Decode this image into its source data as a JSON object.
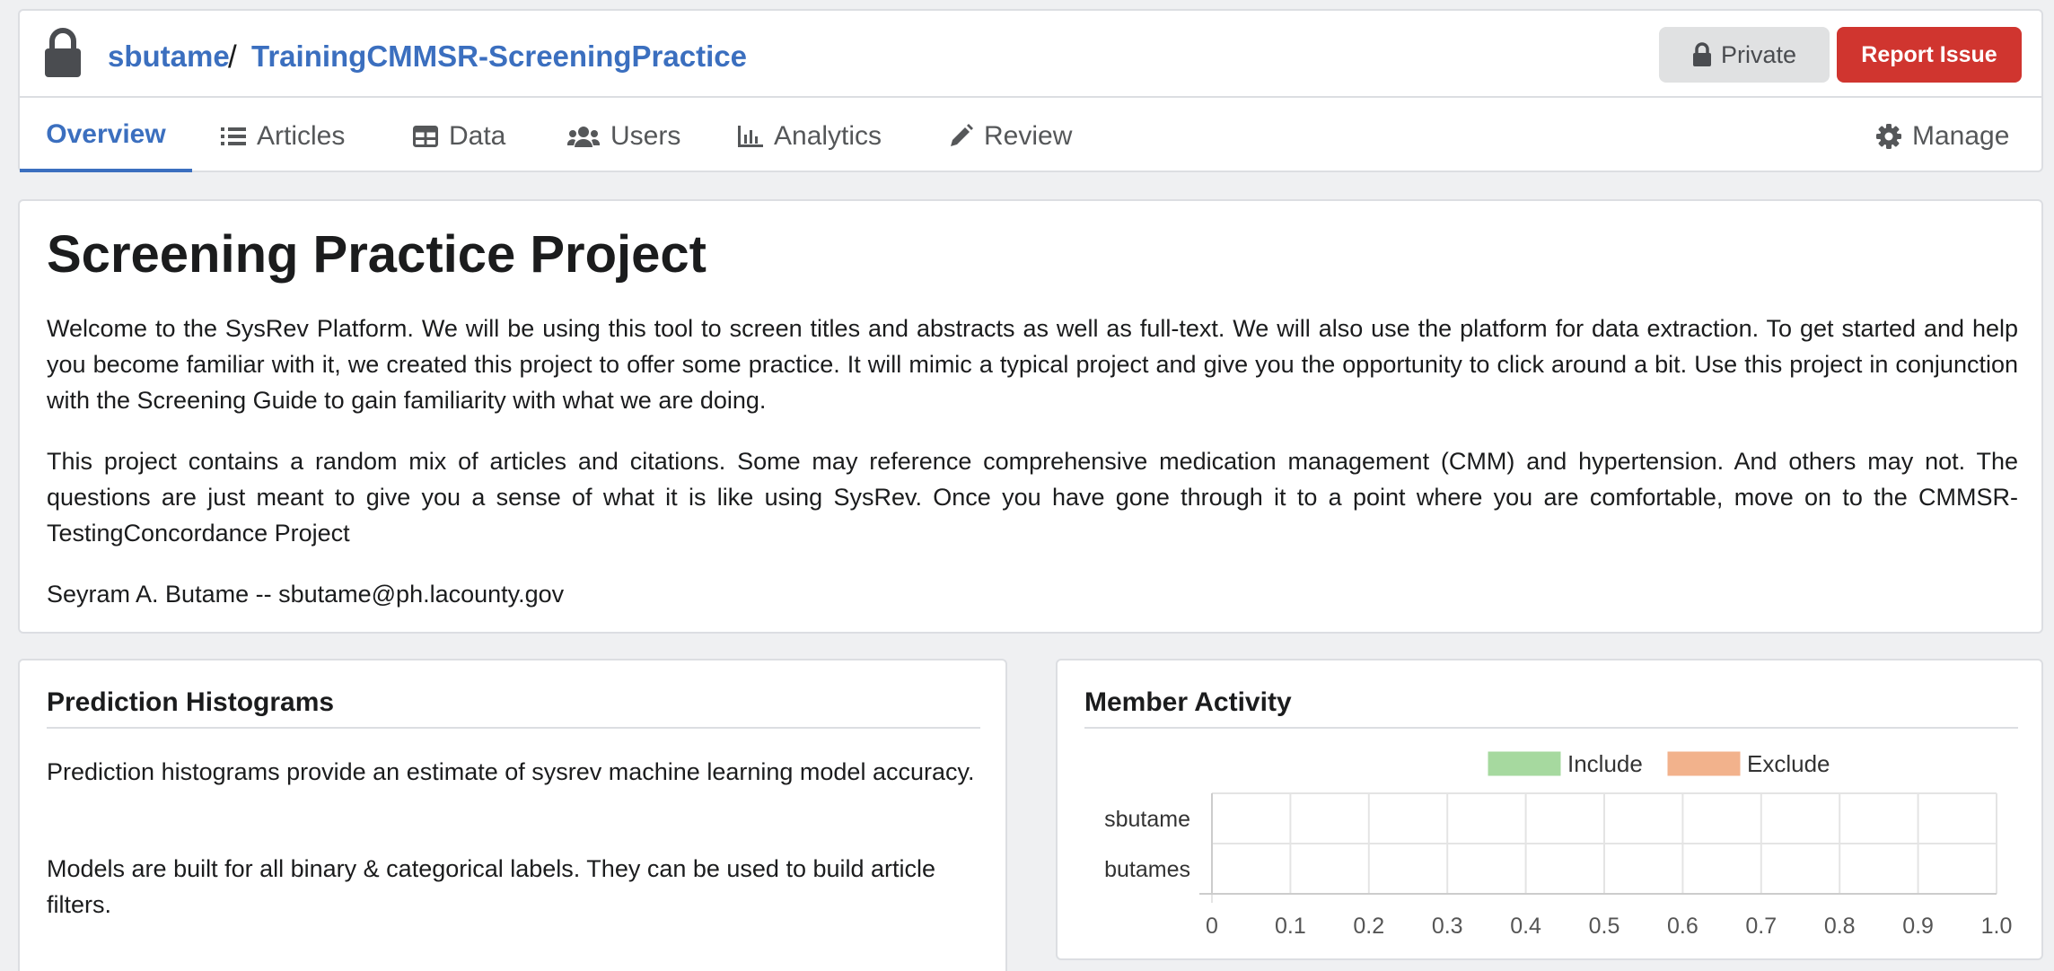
{
  "header": {
    "owner": "sbutame",
    "separator": "/",
    "project": "TrainingCMMSR-ScreeningPractice",
    "private_label": "Private",
    "report_label": "Report Issue"
  },
  "tabs": [
    {
      "label": "Overview",
      "icon": "none",
      "active": true
    },
    {
      "label": "Articles",
      "icon": "list-icon",
      "active": false
    },
    {
      "label": "Data",
      "icon": "table-icon",
      "active": false
    },
    {
      "label": "Users",
      "icon": "users-icon",
      "active": false
    },
    {
      "label": "Analytics",
      "icon": "bar-chart-icon",
      "active": false
    },
    {
      "label": "Review",
      "icon": "pencil-icon",
      "active": false
    }
  ],
  "manage_label": "Manage",
  "project": {
    "title": "Screening Practice Project",
    "paragraphs": [
      "Welcome to the SysRev Platform. We will be using this tool to screen titles and abstracts as well as full-text. We will also use the platform for data extraction. To get started and help you become familiar with it, we created this project to offer some practice. It will mimic a typical project and give you the opportunity to click around a bit. Use this project in conjunction with the Screening Guide to gain familiarity with what we are doing.",
      "This project contains a random mix of articles and citations. Some may reference comprehensive medication management (CMM) and hypertension. And others may not. The questions are just meant to give you a sense of what it is like using SysRev. Once you have gone through it to a point where you are comfortable, move on to the CMMSR-TestingConcordance Project",
      "Seyram A. Butame -- sbutame@ph.lacounty.gov"
    ]
  },
  "prediction": {
    "heading": "Prediction Histograms",
    "paragraphs": [
      "Prediction histograms provide an estimate of sysrev machine learning model accuracy.",
      "Models are built for all binary & categorical labels. They can be used to build article filters."
    ]
  },
  "member_activity": {
    "heading": "Member Activity"
  },
  "chart_data": {
    "type": "bar",
    "orientation": "horizontal",
    "stacked": true,
    "categories": [
      "sbutame",
      "butames"
    ],
    "series": [
      {
        "name": "Include",
        "color": "#a6d99f",
        "values": [
          0,
          0
        ]
      },
      {
        "name": "Exclude",
        "color": "#f2b28c",
        "values": [
          0,
          0
        ]
      }
    ],
    "xlim": [
      0,
      1.0
    ],
    "xticks": [
      "0",
      "0.1",
      "0.2",
      "0.3",
      "0.4",
      "0.5",
      "0.6",
      "0.7",
      "0.8",
      "0.9",
      "1.0"
    ],
    "grid": true,
    "legend": "top-center",
    "title": "",
    "xlabel": "",
    "ylabel": ""
  },
  "colors": {
    "link": "#3b6fbf",
    "danger": "#d0352f",
    "page_bg": "#eff0f2"
  }
}
